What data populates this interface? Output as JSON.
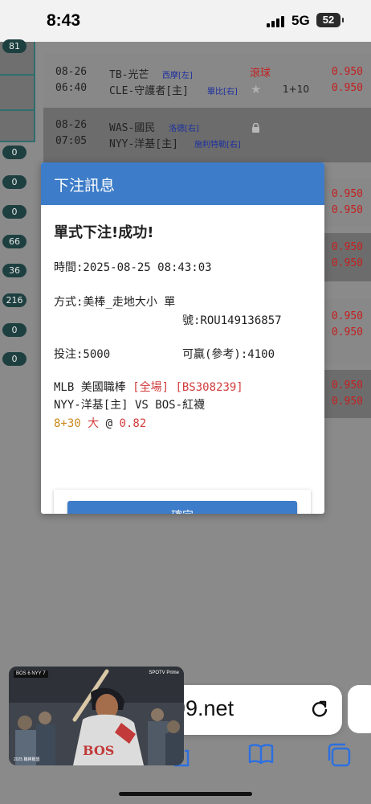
{
  "status": {
    "time": "8:43",
    "network": "5G",
    "battery": "52"
  },
  "sidebar": {
    "badges": [
      "81",
      "0",
      "0",
      "0",
      "66",
      "36",
      "216",
      "0",
      "0"
    ]
  },
  "games": [
    {
      "date": "08-26",
      "time": "06:40",
      "team1": "TB-光芒",
      "pitcher1": "西摩[左]",
      "team2": "CLE-守護者[主]",
      "pitcher2": "畢比[右]",
      "bet": "滾球",
      "handicap": "1+10",
      "odds": [
        "0.950",
        "0.950"
      ]
    },
    {
      "date": "08-26",
      "time": "07:05",
      "team1": "WAS-國民",
      "pitcher1": "洛德[右]",
      "team2": "NYY-洋基[主]",
      "pitcher2": "施利特勒[右]",
      "odds": [
        "0.950",
        "0.950"
      ]
    },
    {
      "odds": [
        "0.950",
        "0.950"
      ]
    },
    {
      "odds": [
        "0.950",
        "0.950"
      ]
    },
    {
      "odds": [
        "0.950",
        "0.950"
      ]
    }
  ],
  "dialog": {
    "title": "下注訊息",
    "success": "單式下注!成功!",
    "time_line": "時間:2025-08-25 08:43:03",
    "method_line": "方式:美棒_走地大小 單",
    "ticket_line": "號:ROU149136857",
    "stake": "投注:5000",
    "win": "可贏(參考):4100",
    "league": "MLB 美國職棒",
    "scope": "[全場]",
    "code": "[BS308239]",
    "matchup": "NYY-洋基[主] VS BOS-紅襪",
    "line_value": "8+30",
    "selection": "大",
    "at": "@",
    "odds": "0.82",
    "confirm": "確定"
  },
  "browser": {
    "url": "99.net"
  },
  "pip": {
    "score": "BOS 6 NYY 7",
    "brand": "SPOTV Prime",
    "footer": "2025 職棒聯盟"
  },
  "colors": {
    "accent": "#3d7cc8",
    "red": "#d23c3c",
    "gold": "#c8881e"
  }
}
